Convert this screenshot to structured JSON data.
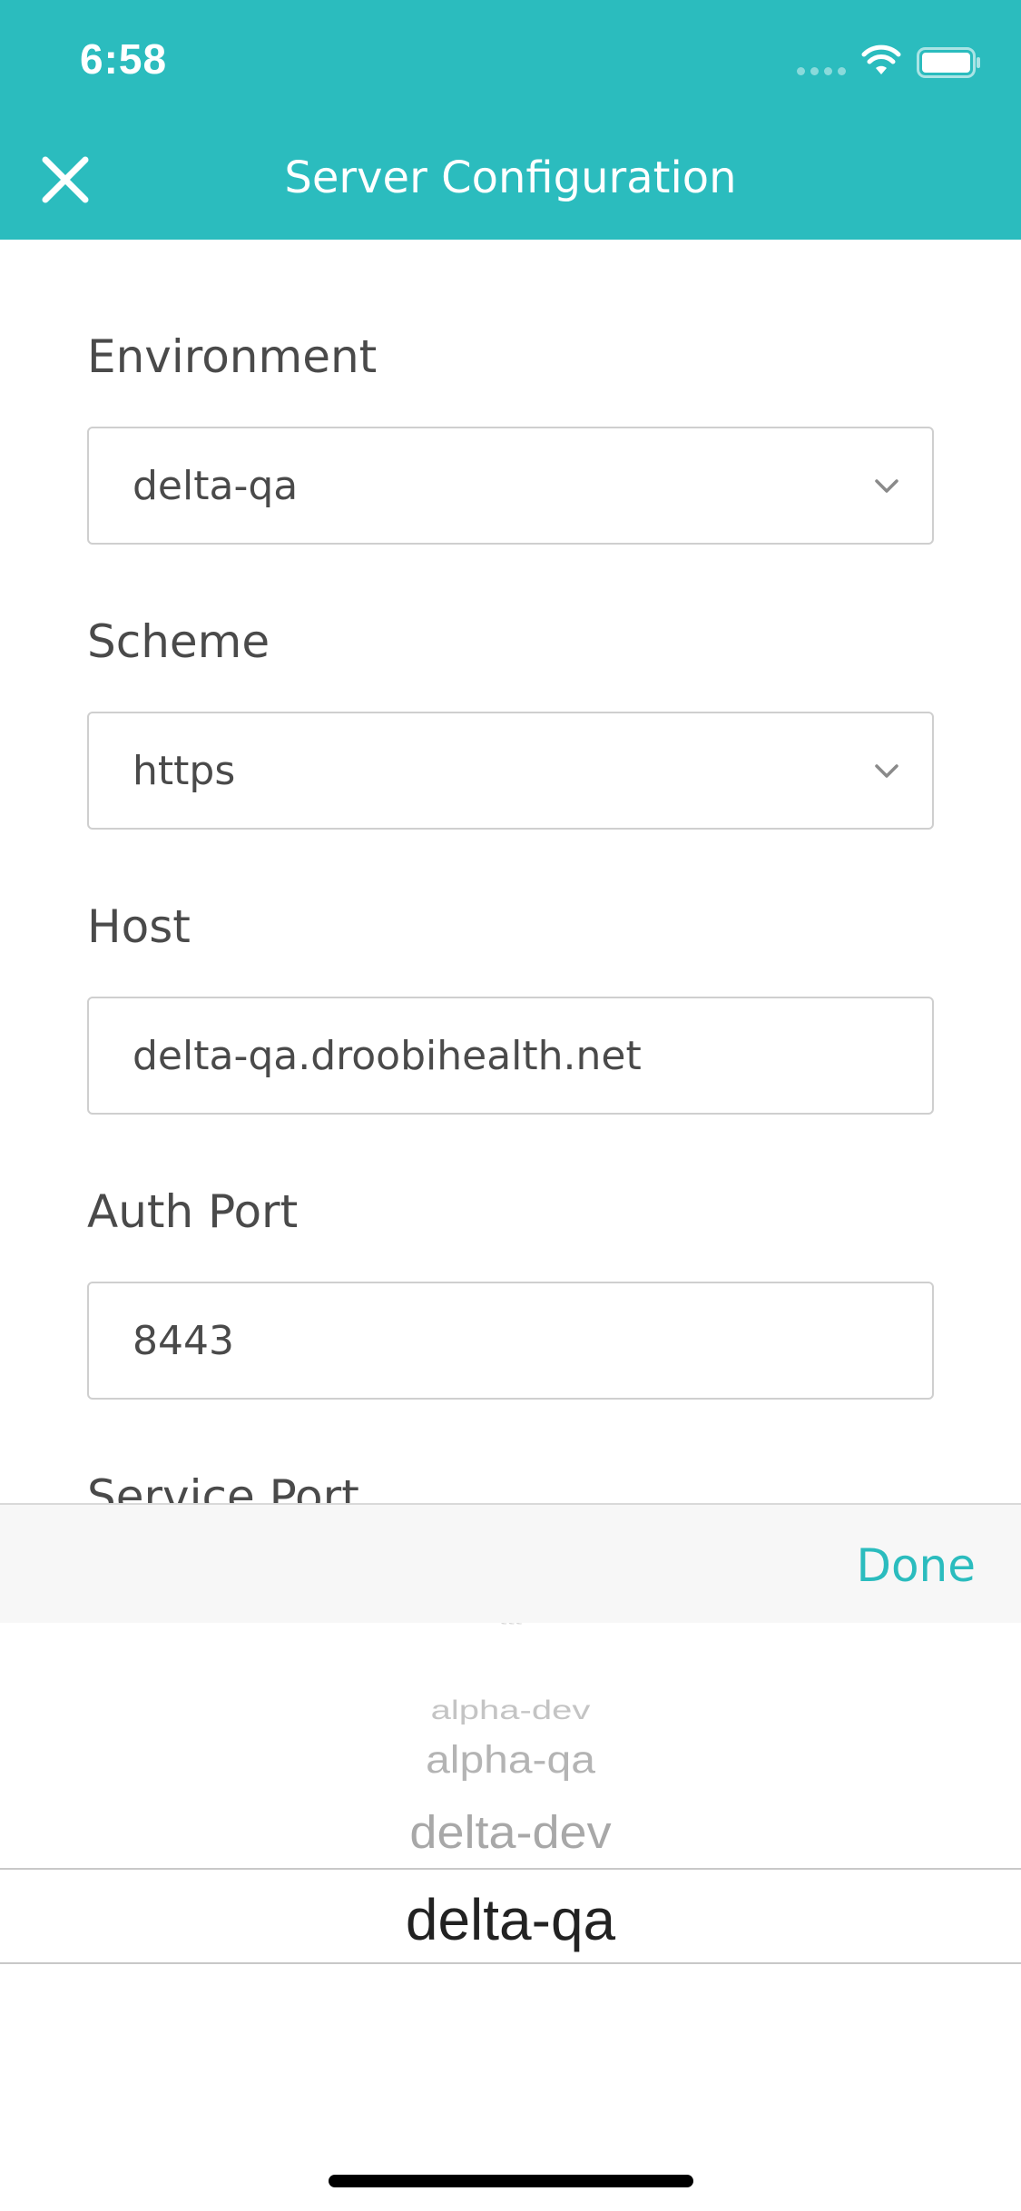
{
  "status_bar": {
    "time": "6:58"
  },
  "header": {
    "title": "Server Configuration",
    "close_icon": "close-icon",
    "background": "#2bbcbe"
  },
  "form": {
    "environment": {
      "label": "Environment",
      "value": "delta-qa"
    },
    "scheme": {
      "label": "Scheme",
      "value": "https"
    },
    "host": {
      "label": "Host",
      "value": "delta-qa.droobihealth.net"
    },
    "auth_port": {
      "label": "Auth Port",
      "value": "8443"
    },
    "service_port": {
      "label": "Service Port"
    }
  },
  "picker_toolbar": {
    "done_label": "Done"
  },
  "picker": {
    "items": [
      "alpha-dev",
      "alpha-qa",
      "delta-dev",
      "delta-qa"
    ],
    "selected": "delta-qa"
  },
  "colors": {
    "accent": "#2bbcbe",
    "text": "#4a4a4a",
    "border": "#cfcfcf"
  }
}
